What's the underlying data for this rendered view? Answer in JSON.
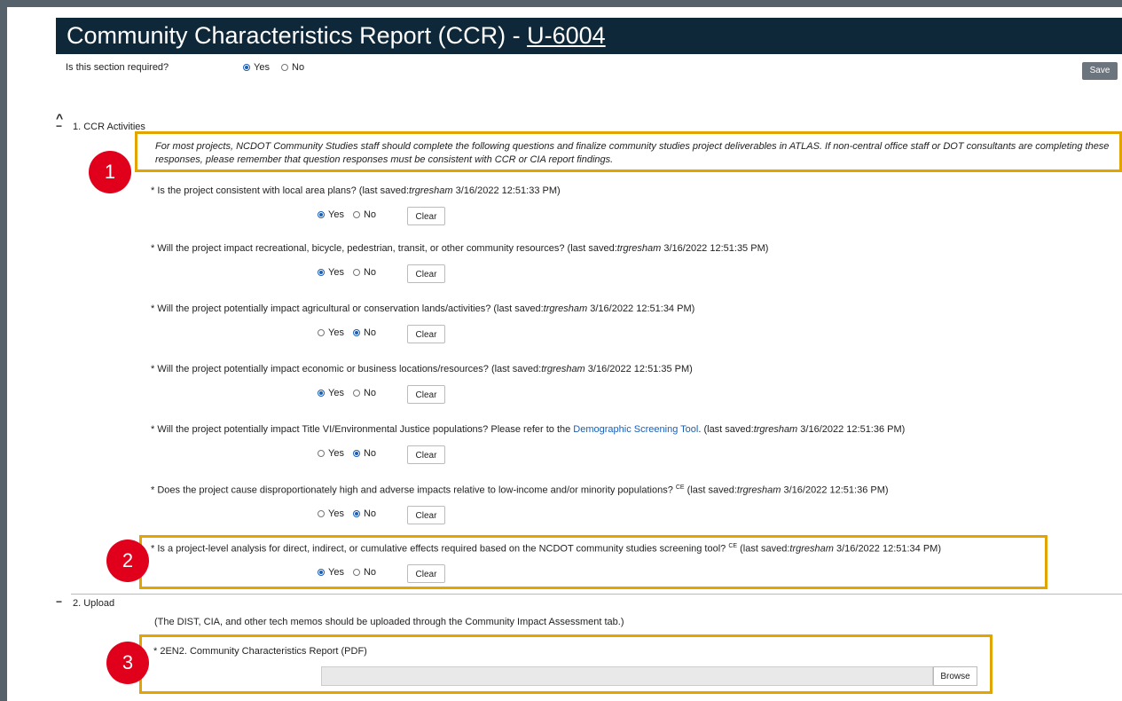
{
  "header": {
    "title": "Community Characteristics Report (CCR) - ",
    "project_link": "U-6004"
  },
  "section_required": {
    "label": "Is this section required?",
    "yes": "Yes",
    "no": "No",
    "selected": "Yes"
  },
  "toolbar": {
    "save_label": "Save"
  },
  "sections": [
    {
      "label": "1. CCR Activities"
    },
    {
      "label": "2. Upload"
    }
  ],
  "ccr_note": "For most projects, NCDOT Community Studies staff should complete the following questions and finalize community studies project deliverables in ATLAS. If non-central office staff or DOT consultants are completing these responses, please remember that question responses must be consistent with CCR or CIA report findings.",
  "questions": [
    {
      "text": "* Is the project consistent with local area plans? (last saved:",
      "user": "trgresham",
      "saved": " 3/16/2022 12:51:33 PM)",
      "selected": "Yes"
    },
    {
      "text": "* Will the project impact recreational, bicycle, pedestrian, transit, or other community resources? (last saved:",
      "user": "trgresham",
      "saved": " 3/16/2022 12:51:35 PM)",
      "selected": "Yes"
    },
    {
      "text": "* Will the project potentially impact agricultural or conservation lands/activities? (last saved:",
      "user": "trgresham",
      "saved": " 3/16/2022 12:51:34 PM)",
      "selected": "No"
    },
    {
      "text": "* Will the project potentially impact economic or business locations/resources? (last saved:",
      "user": "trgresham",
      "saved": " 3/16/2022 12:51:35 PM)",
      "selected": "Yes"
    },
    {
      "text": "* Will the project potentially impact Title VI/Environmental Justice populations? Please refer to the ",
      "link": "Demographic Screening Tool",
      "text2": ". (last saved:",
      "user": "trgresham",
      "saved": " 3/16/2022 12:51:36 PM)",
      "selected": "No"
    },
    {
      "text": "* Does the project cause disproportionately high and adverse impacts relative to low-income and/or minority populations? ",
      "sup": "CE",
      "text2": " (last saved:",
      "user": "trgresham",
      "saved": " 3/16/2022 12:51:36 PM)",
      "selected": "No"
    },
    {
      "text": "* Is a project-level analysis for direct, indirect, or cumulative effects required based on the NCDOT community studies screening tool? ",
      "sup": "CE",
      "text2": " (last saved:",
      "user": "trgresham",
      "saved": " 3/16/2022 12:51:34 PM)",
      "selected": "Yes"
    }
  ],
  "options": {
    "yes": "Yes",
    "no": "No",
    "clear": "Clear"
  },
  "upload": {
    "note": "(The DIST, CIA, and other tech memos should be uploaded through the Community Impact Assessment tab.)",
    "field_label": "* 2EN2. Community Characteristics Report (PDF)",
    "browse_label": "Browse"
  },
  "callouts": [
    "1",
    "2",
    "3"
  ],
  "colors": {
    "header_bg": "#0e2839",
    "highlight": "#e2a400",
    "badge": "#e0001b",
    "link": "#1a5fb4"
  }
}
